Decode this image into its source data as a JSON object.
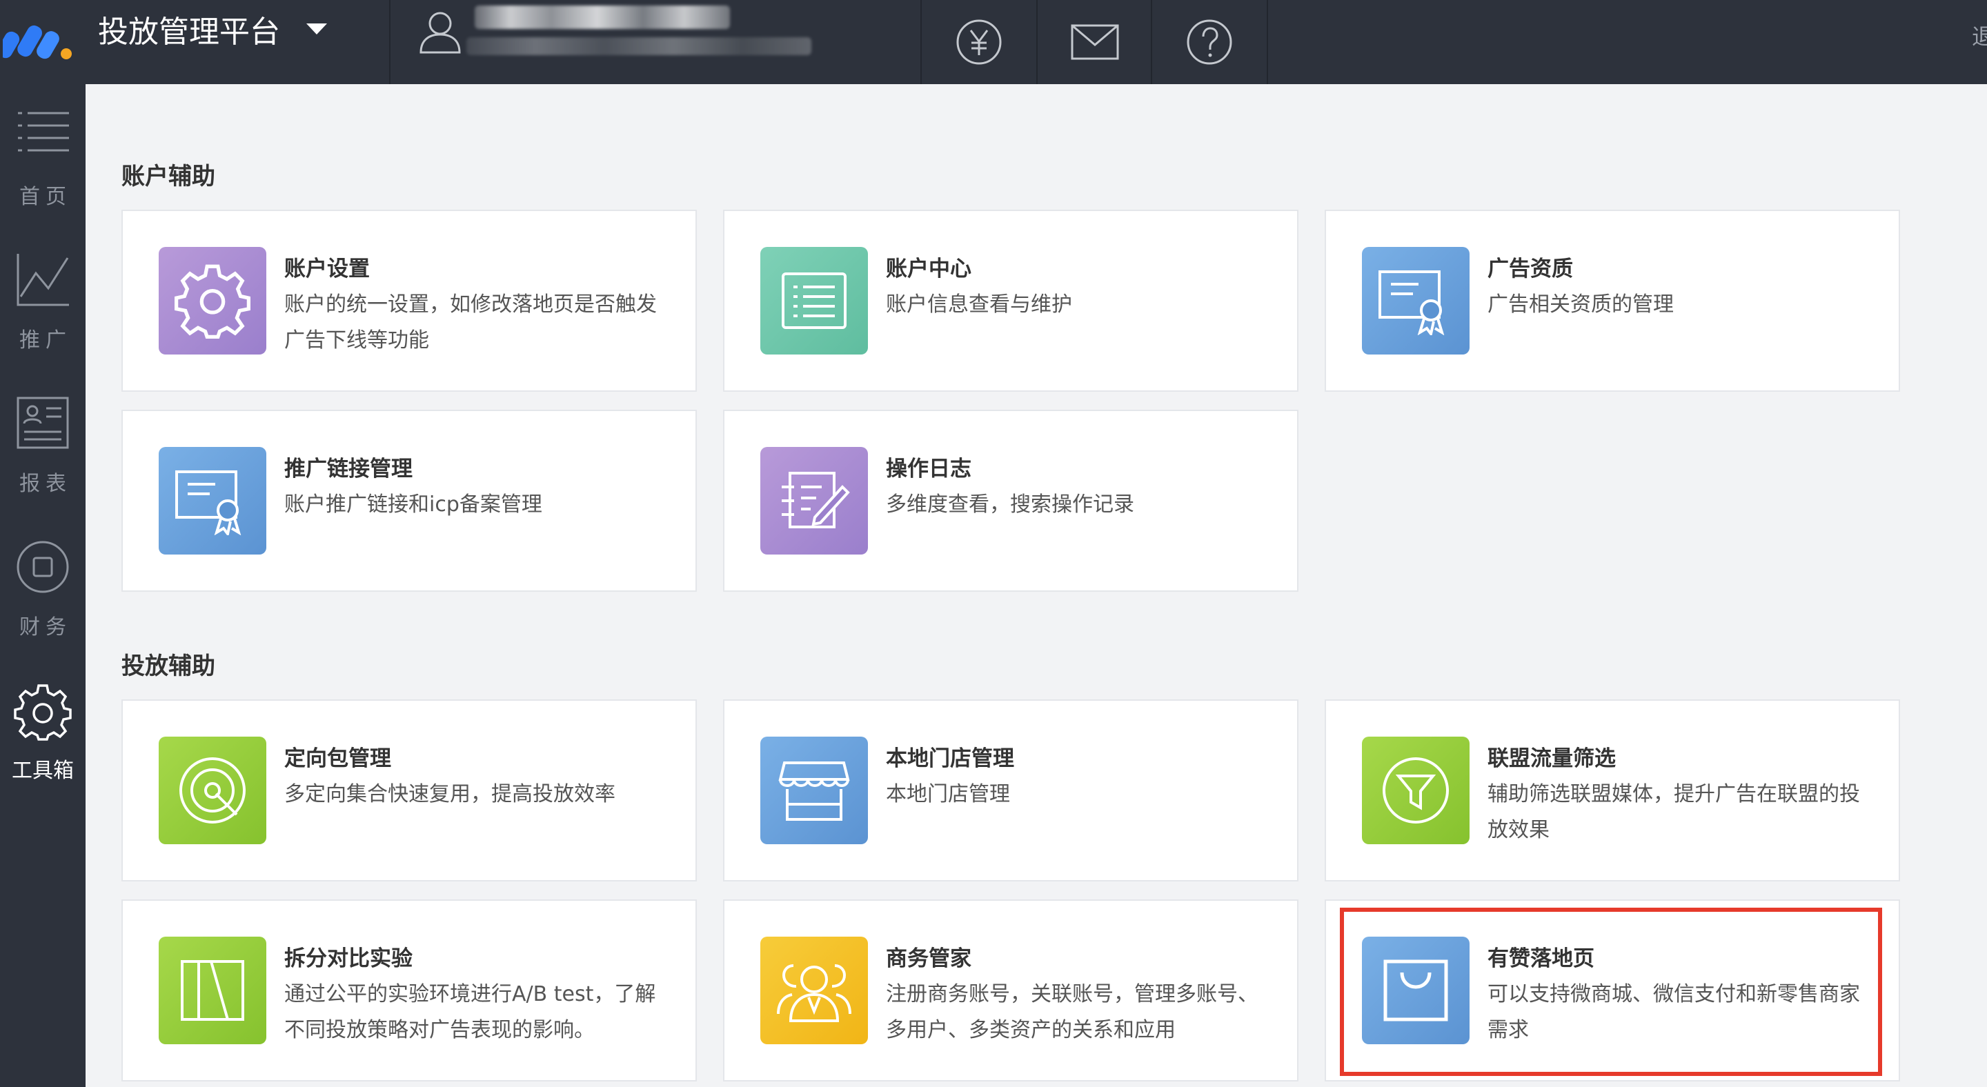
{
  "header": {
    "title": "投放管理平台",
    "logout_label": "退",
    "icons": [
      "yuan-icon",
      "mail-icon",
      "help-icon"
    ]
  },
  "sidebar": {
    "items": [
      {
        "label": "首页",
        "icon": "menu-list-icon"
      },
      {
        "label": "推广",
        "icon": "line-chart-icon"
      },
      {
        "label": "报表",
        "icon": "report-icon"
      },
      {
        "label": "财务",
        "icon": "finance-icon"
      },
      {
        "label": "工具箱",
        "icon": "gear-icon",
        "active": true
      }
    ]
  },
  "sections": [
    {
      "title": "账户辅助",
      "cards": [
        {
          "title": "账户设置",
          "desc": "账户的统一设置，如修改落地页是否触发广告下线等功能",
          "icon": "gear-icon",
          "color": "#a98bd3"
        },
        {
          "title": "账户中心",
          "desc": "账户信息查看与维护",
          "icon": "list-icon",
          "color": "#6cc8aa"
        },
        {
          "title": "广告资质",
          "desc": "广告相关资质的管理",
          "icon": "certificate-icon",
          "color": "#67a2dc"
        },
        {
          "title": "推广链接管理",
          "desc": "账户推广链接和icp备案管理",
          "icon": "certificate-icon",
          "color": "#67a2dc"
        },
        {
          "title": "操作日志",
          "desc": "多维度查看，搜索操作记录",
          "icon": "log-icon",
          "color": "#a98bd3"
        }
      ]
    },
    {
      "title": "投放辅助",
      "cards": [
        {
          "title": "定向包管理",
          "desc": "多定向集合快速复用，提高投放效率",
          "icon": "target-icon",
          "color": "#95cd3a"
        },
        {
          "title": "本地门店管理",
          "desc": "本地门店管理",
          "icon": "store-icon",
          "color": "#67a2dc"
        },
        {
          "title": "联盟流量筛选",
          "desc": "辅助筛选联盟媒体，提升广告在联盟的投放效果",
          "icon": "filter-icon",
          "color": "#95cd3a"
        },
        {
          "title": "拆分对比实验",
          "desc": "通过公平的实验环境进行A/B test，了解不同投放策略对广告表现的影响。",
          "icon": "split-icon",
          "color": "#95cd3a"
        },
        {
          "title": "商务管家",
          "desc": "注册商务账号，关联账号，管理多账号、多用户、多类资产的关系和应用",
          "icon": "users-icon",
          "color": "#f4c22a"
        },
        {
          "title": "有赞落地页",
          "desc": "可以支持微商城、微信支付和新零售商家需求",
          "icon": "shopping-bag-icon",
          "color": "#67a2dc",
          "highlighted": true
        }
      ]
    }
  ]
}
